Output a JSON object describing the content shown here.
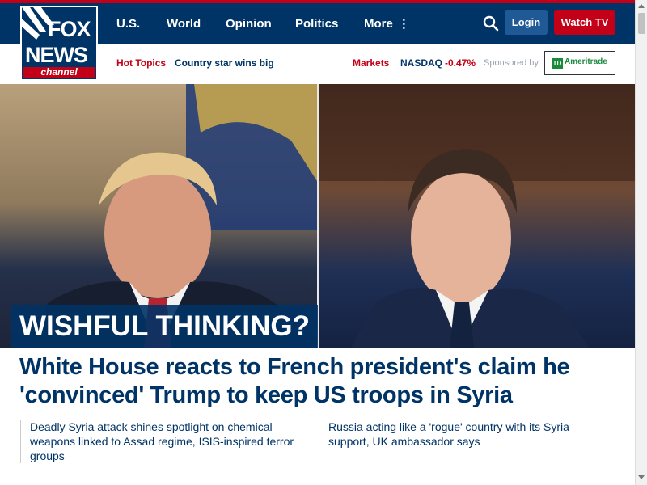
{
  "brand": {
    "fox": "FOX",
    "news": "NEWS",
    "channel": "channel"
  },
  "nav": {
    "us": "U.S.",
    "world": "World",
    "opinion": "Opinion",
    "politics": "Politics",
    "more": "More"
  },
  "header": {
    "login": "Login",
    "watch": "Watch TV"
  },
  "subnav": {
    "hot_topics": "Hot Topics",
    "trending": "Country star wins big",
    "markets": "Markets",
    "nasdaq_label": "NASDAQ",
    "nasdaq_change": "-0.47%",
    "sponsored": "Sponsored by",
    "sponsor": "Ameritrade",
    "sponsor_mark": "TD"
  },
  "hero": {
    "kicker": "WISHFUL THINKING?"
  },
  "main": {
    "headline": "White House reacts to French president's claim he 'convinced' Trump to keep US troops in Syria",
    "related": [
      "Deadly Syria attack shines spotlight on chemical weapons linked to Assad regime, ISIS-inspired terror groups",
      "Russia acting like a 'rogue' country with its Syria support, UK ambassador says"
    ]
  },
  "colors": {
    "brand_navy": "#003366",
    "brand_red": "#c20017",
    "market_down": "#c20017"
  },
  "icons": {
    "search": "search-icon",
    "more": "vertical-dots-icon"
  }
}
